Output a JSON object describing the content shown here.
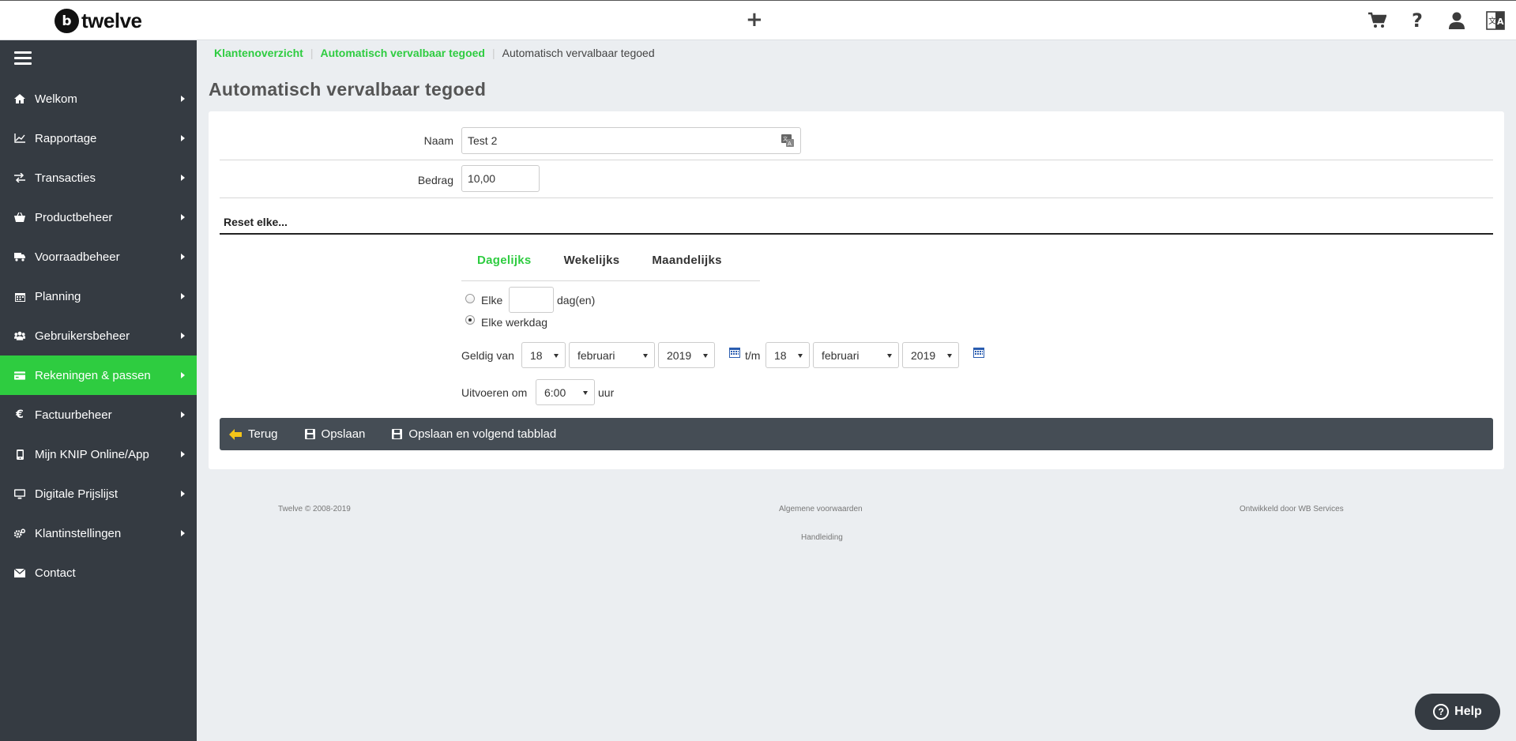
{
  "header": {
    "logo_mark": "b",
    "logo_text": "twelve",
    "plus_label": "+"
  },
  "sidebar": {
    "items": [
      {
        "label": "Welkom",
        "icon": "home-icon",
        "arrow": true
      },
      {
        "label": "Rapportage",
        "icon": "line-chart-icon",
        "arrow": true
      },
      {
        "label": "Transacties",
        "icon": "exchange-icon",
        "arrow": true
      },
      {
        "label": "Productbeheer",
        "icon": "basket-icon",
        "arrow": true
      },
      {
        "label": "Voorraadbeheer",
        "icon": "truck-icon",
        "arrow": true
      },
      {
        "label": "Planning",
        "icon": "calendar-icon",
        "arrow": true
      },
      {
        "label": "Gebruikersbeheer",
        "icon": "users-icon",
        "arrow": true
      },
      {
        "label": "Rekeningen & passen",
        "icon": "credit-card-icon",
        "arrow": true,
        "active": true
      },
      {
        "label": "Factuurbeheer",
        "icon": "euro-icon",
        "arrow": true
      },
      {
        "label": "Mijn KNIP Online/App",
        "icon": "mobile-icon",
        "arrow": true
      },
      {
        "label": "Digitale Prijslijst",
        "icon": "monitor-icon",
        "arrow": true
      },
      {
        "label": "Klantinstellingen",
        "icon": "cogs-icon",
        "arrow": true
      },
      {
        "label": "Contact",
        "icon": "envelope-icon",
        "arrow": false
      }
    ]
  },
  "breadcrumb": {
    "items": [
      "Klantenoverzicht",
      "Automatisch vervalbaar tegoed"
    ],
    "current": "Automatisch vervalbaar tegoed"
  },
  "page": {
    "title": "Automatisch vervalbaar tegoed"
  },
  "form": {
    "naam_label": "Naam",
    "naam_value": "Test 2",
    "bedrag_label": "Bedrag",
    "bedrag_value": "10,00",
    "reset_title": "Reset elke...",
    "tabs": [
      "Dagelijks",
      "Wekelijks",
      "Maandelijks"
    ],
    "active_tab": "Dagelijks",
    "option_elke": "Elke",
    "option_elke_value": "",
    "option_dagen": "dag(en)",
    "option_werkdag": "Elke werkdag",
    "geldig_van_label": "Geldig van",
    "van_day": "18",
    "van_month": "februari",
    "van_year": "2019",
    "tm_label": "t/m",
    "tot_day": "18",
    "tot_month": "februari",
    "tot_year": "2019",
    "uitvoeren_label": "Uitvoeren om",
    "uitvoeren_time": "6:00",
    "uur_label": "uur"
  },
  "actions": {
    "back": "Terug",
    "save": "Opslaan",
    "save_next": "Opslaan en volgend tabblad"
  },
  "footer": {
    "copyright": "Twelve © 2008-2019",
    "terms": "Algemene voorwaarden",
    "manual": "Handleiding",
    "developer": "Ontwikkeld door WB Services"
  },
  "help": {
    "label": "Help"
  },
  "colors": {
    "accent": "#2ecc40",
    "sidebar": "#353b42",
    "actionbar": "#454d55"
  }
}
